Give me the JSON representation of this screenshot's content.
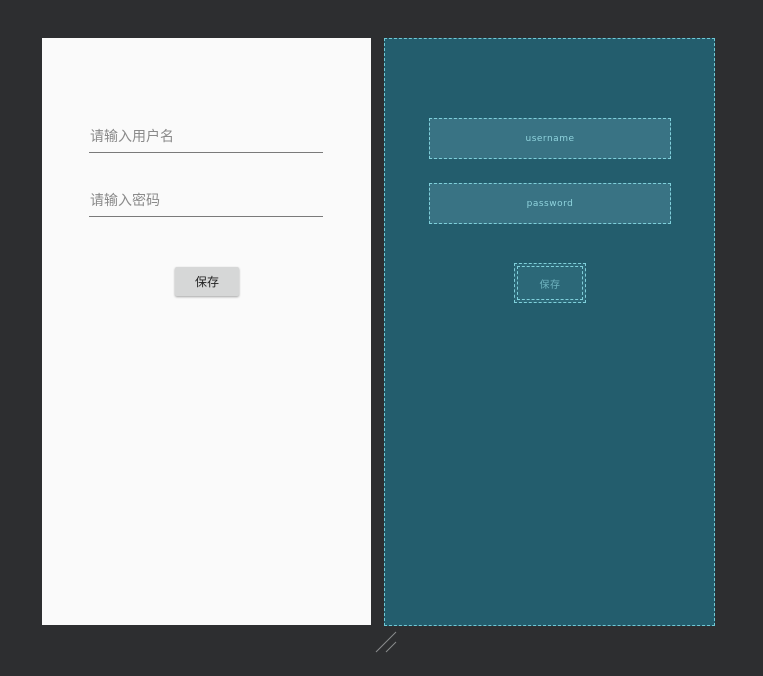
{
  "design": {
    "username_placeholder": "请输入用户名",
    "password_placeholder": "请输入密码",
    "save_label": "保存"
  },
  "blueprint": {
    "username_label": "username",
    "password_label": "password",
    "save_label": "保存"
  },
  "icons": {
    "resize_grip": "resize-grip-icon"
  },
  "colors": {
    "background": "#2d2e30",
    "design_surface": "#fafafa",
    "blueprint_surface": "#235d6d",
    "blueprint_stroke": "#7fd0db"
  }
}
